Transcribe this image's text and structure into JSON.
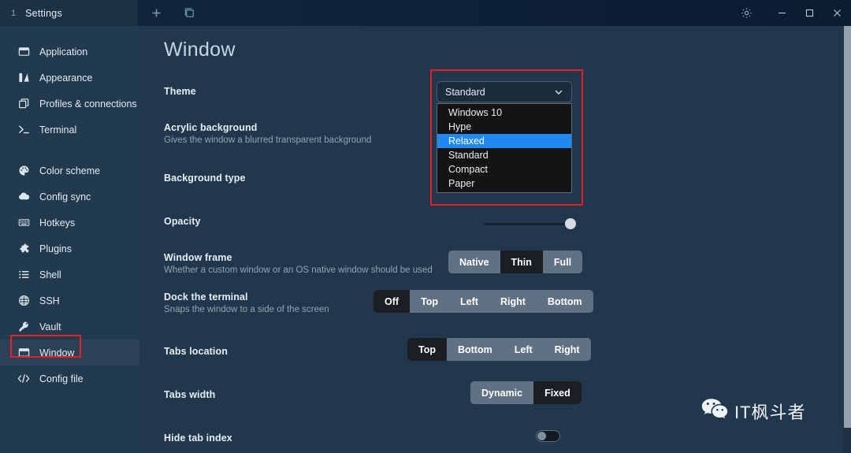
{
  "titlebar": {
    "tab_index": "1",
    "tab_title": "Settings",
    "new_tab_label": "+",
    "split_pane_label": "",
    "settings_label": "",
    "minimize_label": "",
    "maximize_label": "",
    "close_label": ""
  },
  "sidebar": {
    "items": [
      {
        "label": "Application",
        "icon": "application-icon",
        "active": false
      },
      {
        "label": "Appearance",
        "icon": "appearance-icon",
        "active": false
      },
      {
        "label": "Profiles & connections",
        "icon": "profiles-icon",
        "active": false
      },
      {
        "label": "Terminal",
        "icon": "terminal-icon",
        "active": false
      },
      {
        "label": "Color scheme",
        "icon": "palette-icon",
        "active": false
      },
      {
        "label": "Config sync",
        "icon": "cloud-icon",
        "active": false
      },
      {
        "label": "Hotkeys",
        "icon": "keyboard-icon",
        "active": false
      },
      {
        "label": "Plugins",
        "icon": "plugin-icon",
        "active": false
      },
      {
        "label": "Shell",
        "icon": "list-icon",
        "active": false
      },
      {
        "label": "SSH",
        "icon": "globe-icon",
        "active": false
      },
      {
        "label": "Vault",
        "icon": "key-icon",
        "active": false
      },
      {
        "label": "Window",
        "icon": "window-icon",
        "active": true
      },
      {
        "label": "Config file",
        "icon": "code-icon",
        "active": false
      }
    ]
  },
  "main": {
    "page_title": "Window",
    "rows": {
      "theme": {
        "label": "Theme"
      },
      "acrylic": {
        "label": "Acrylic background",
        "desc": "Gives the window a blurred transparent background"
      },
      "background_type": {
        "label": "Background type"
      },
      "opacity": {
        "label": "Opacity"
      },
      "window_frame": {
        "label": "Window frame",
        "desc": "Whether a custom window or an OS native window should be used",
        "options": [
          "Native",
          "Thin",
          "Full"
        ],
        "selected": "Thin"
      },
      "dock_terminal": {
        "label": "Dock the terminal",
        "desc": "Snaps the window to a side of the screen",
        "options": [
          "Off",
          "Top",
          "Left",
          "Right",
          "Bottom"
        ],
        "selected": "Off"
      },
      "tabs_location": {
        "label": "Tabs location",
        "options": [
          "Top",
          "Bottom",
          "Left",
          "Right"
        ],
        "selected": "Top"
      },
      "tabs_width": {
        "label": "Tabs width",
        "options": [
          "Dynamic",
          "Fixed"
        ],
        "selected": "Fixed"
      },
      "hide_tab_index": {
        "label": "Hide tab index",
        "value": "off"
      }
    },
    "theme_select": {
      "value": "Standard",
      "options": [
        "Windows 10",
        "Hype",
        "Relaxed",
        "Standard",
        "Compact",
        "Paper"
      ],
      "highlighted": "Relaxed"
    }
  },
  "watermark": {
    "text": "IT枫斗者",
    "icon": "wechat-icon"
  },
  "colors": {
    "accent": "#2089f0",
    "annotation": "#e81f25",
    "window_bg": "#21384c",
    "titlebar_bg": "#0f2236",
    "selected_segment": "#1b1f24",
    "segment_bg": "#5f7183"
  }
}
